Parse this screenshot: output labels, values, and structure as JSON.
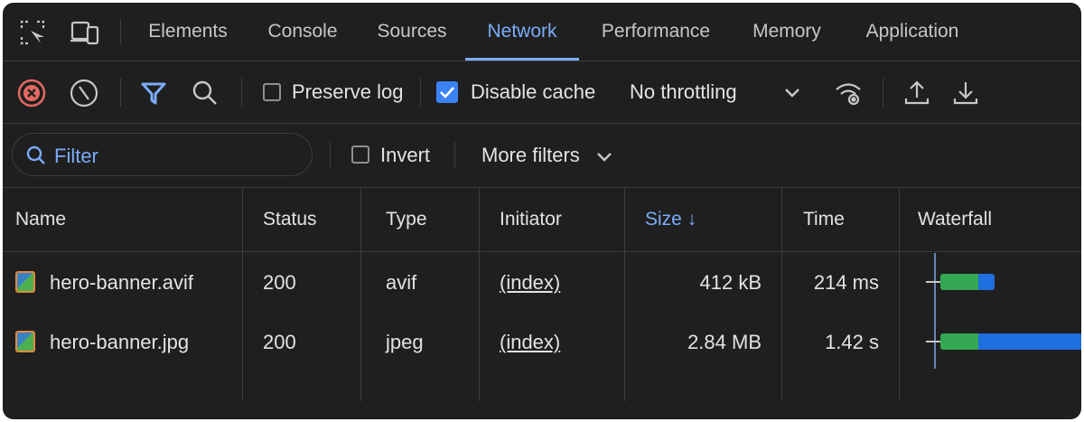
{
  "tabs": [
    {
      "label": "Elements"
    },
    {
      "label": "Console"
    },
    {
      "label": "Sources"
    },
    {
      "label": "Network"
    },
    {
      "label": "Performance"
    },
    {
      "label": "Memory"
    },
    {
      "label": "Application"
    }
  ],
  "active_tab": "Network",
  "toolbar": {
    "preserve_log_label": "Preserve log",
    "preserve_log_checked": false,
    "disable_cache_label": "Disable cache",
    "disable_cache_checked": true,
    "throttling_value": "No throttling"
  },
  "filterbar": {
    "filter_placeholder": "Filter",
    "invert_label": "Invert",
    "more_filters_label": "More filters"
  },
  "table": {
    "columns": [
      "Name",
      "Status",
      "Type",
      "Initiator",
      "Size ↓",
      "Time",
      "Waterfall"
    ],
    "sorted_column": "Size",
    "rows": [
      {
        "name": "hero-banner.avif",
        "status": "200",
        "type": "avif",
        "initiator": "(index)",
        "size": "412 kB",
        "time": "214 ms"
      },
      {
        "name": "hero-banner.jpg",
        "status": "200",
        "type": "jpeg",
        "initiator": "(index)",
        "size": "2.84 MB",
        "time": "1.42 s"
      }
    ]
  },
  "colors": {
    "accent": "#7cacf8",
    "error": "#e46962",
    "waterfall_wait": "#34a853",
    "waterfall_download": "#1f6fe0"
  }
}
